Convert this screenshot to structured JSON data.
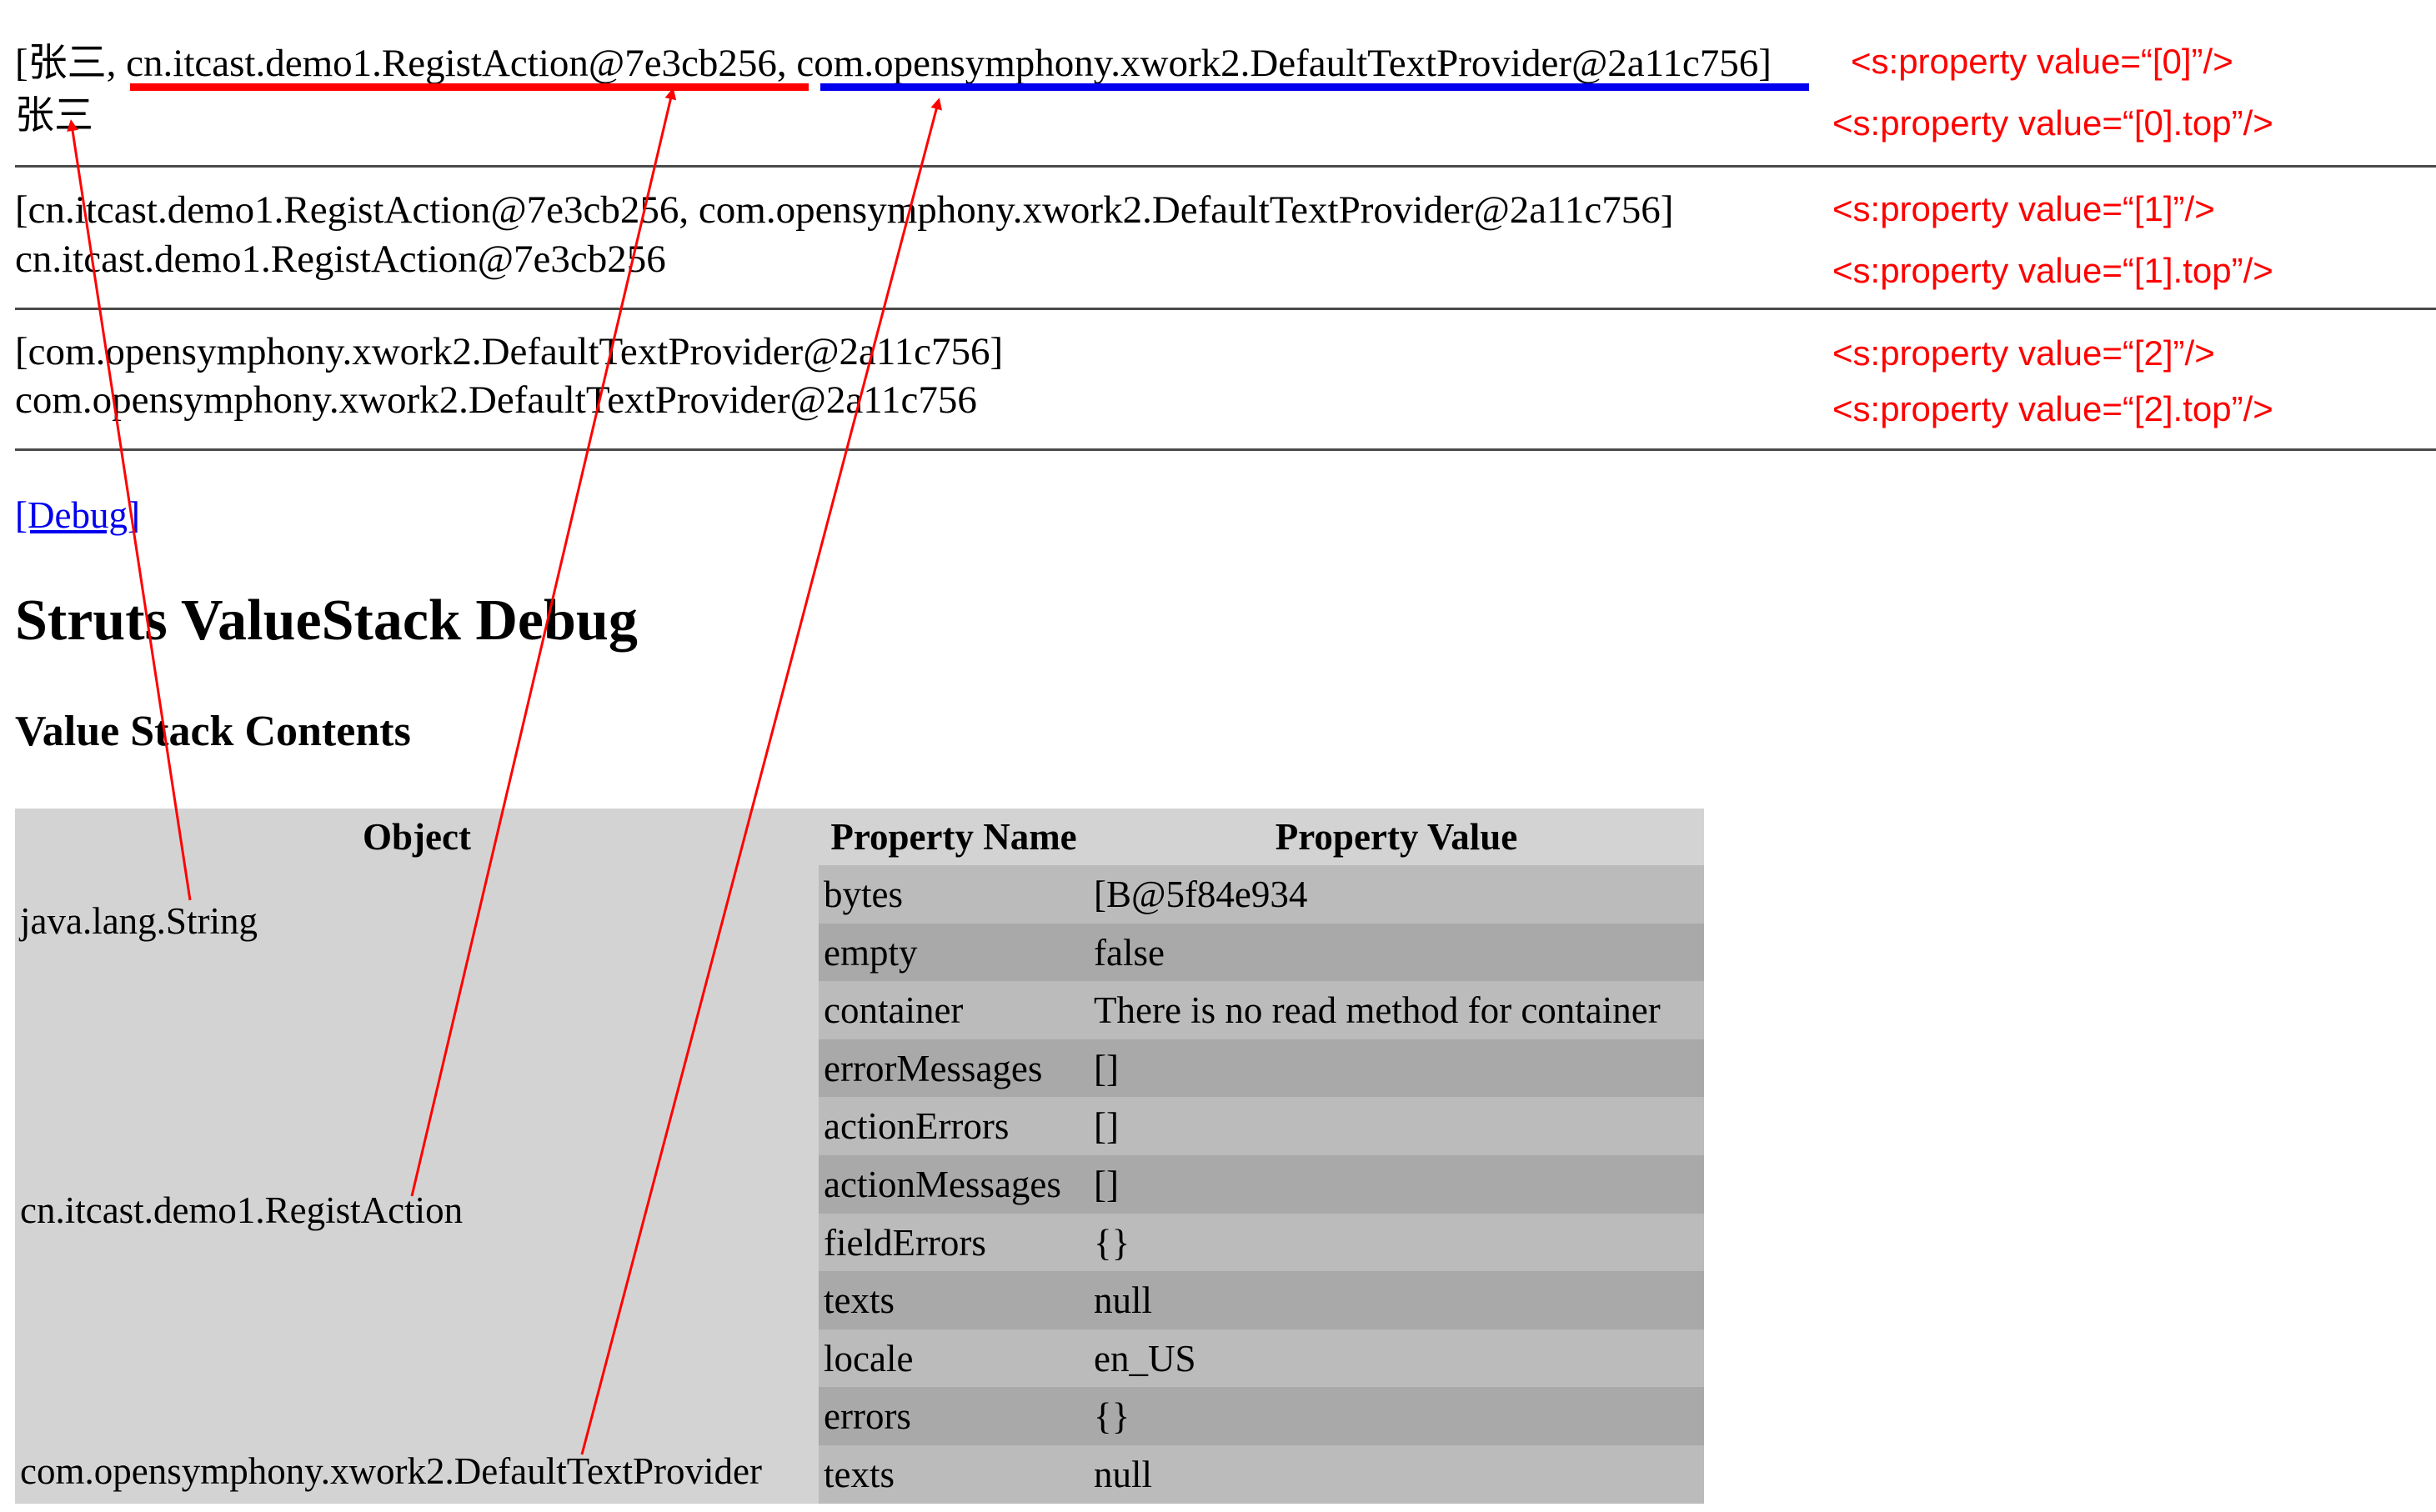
{
  "rows": [
    {
      "line1_prefix": "[张三, ",
      "line1_action": "cn.itcast.demo1.RegistAction@7e3cb256",
      "line1_sep": ", ",
      "line1_provider": "com.opensymphony.xwork2.DefaultTextProvider@2a11c756",
      "line1_suffix": "]",
      "line2": "张三",
      "note1": "<s:property value=“[0]”/>",
      "note2": "<s:property value=“[0].top”/>"
    },
    {
      "line1": "[cn.itcast.demo1.RegistAction@7e3cb256, com.opensymphony.xwork2.DefaultTextProvider@2a11c756]",
      "line2": "cn.itcast.demo1.RegistAction@7e3cb256",
      "note1": "<s:property value=“[1]”/>",
      "note2": "<s:property value=“[1].top”/>"
    },
    {
      "line1": "[com.opensymphony.xwork2.DefaultTextProvider@2a11c756]",
      "line2": "com.opensymphony.xwork2.DefaultTextProvider@2a11c756",
      "note1": "<s:property value=“[2]”/>",
      "note2": "<s:property value=“[2].top”/>"
    }
  ],
  "debug_link": "[Debug]",
  "heading": "Struts ValueStack Debug",
  "subheading": "Value Stack Contents",
  "table": {
    "headers": {
      "object": "Object",
      "property_name": "Property Name",
      "property_value": "Property Value"
    },
    "objects": [
      "java.lang.String",
      "cn.itcast.demo1.RegistAction",
      "com.opensymphony.xwork2.DefaultTextProvider"
    ],
    "properties": [
      {
        "name": "bytes",
        "value": "[B@5f84e934"
      },
      {
        "name": "empty",
        "value": "false"
      },
      {
        "name": "container",
        "value": "There is no read method for container"
      },
      {
        "name": "errorMessages",
        "value": "[]"
      },
      {
        "name": "actionErrors",
        "value": "[]"
      },
      {
        "name": "actionMessages",
        "value": "[]"
      },
      {
        "name": "fieldErrors",
        "value": "{}"
      },
      {
        "name": "texts",
        "value": "null"
      },
      {
        "name": "locale",
        "value": "en_US"
      },
      {
        "name": "errors",
        "value": "{}"
      },
      {
        "name": "texts",
        "value": "null"
      }
    ]
  },
  "colors": {
    "annotation_red": "#ff0000",
    "underline_red": "#ff0000",
    "underline_blue": "#0000ee",
    "link_blue": "#0000ee",
    "table_light": "#d3d3d3",
    "table_mid": "#bbbbbb",
    "table_dark": "#a9a9a9"
  }
}
